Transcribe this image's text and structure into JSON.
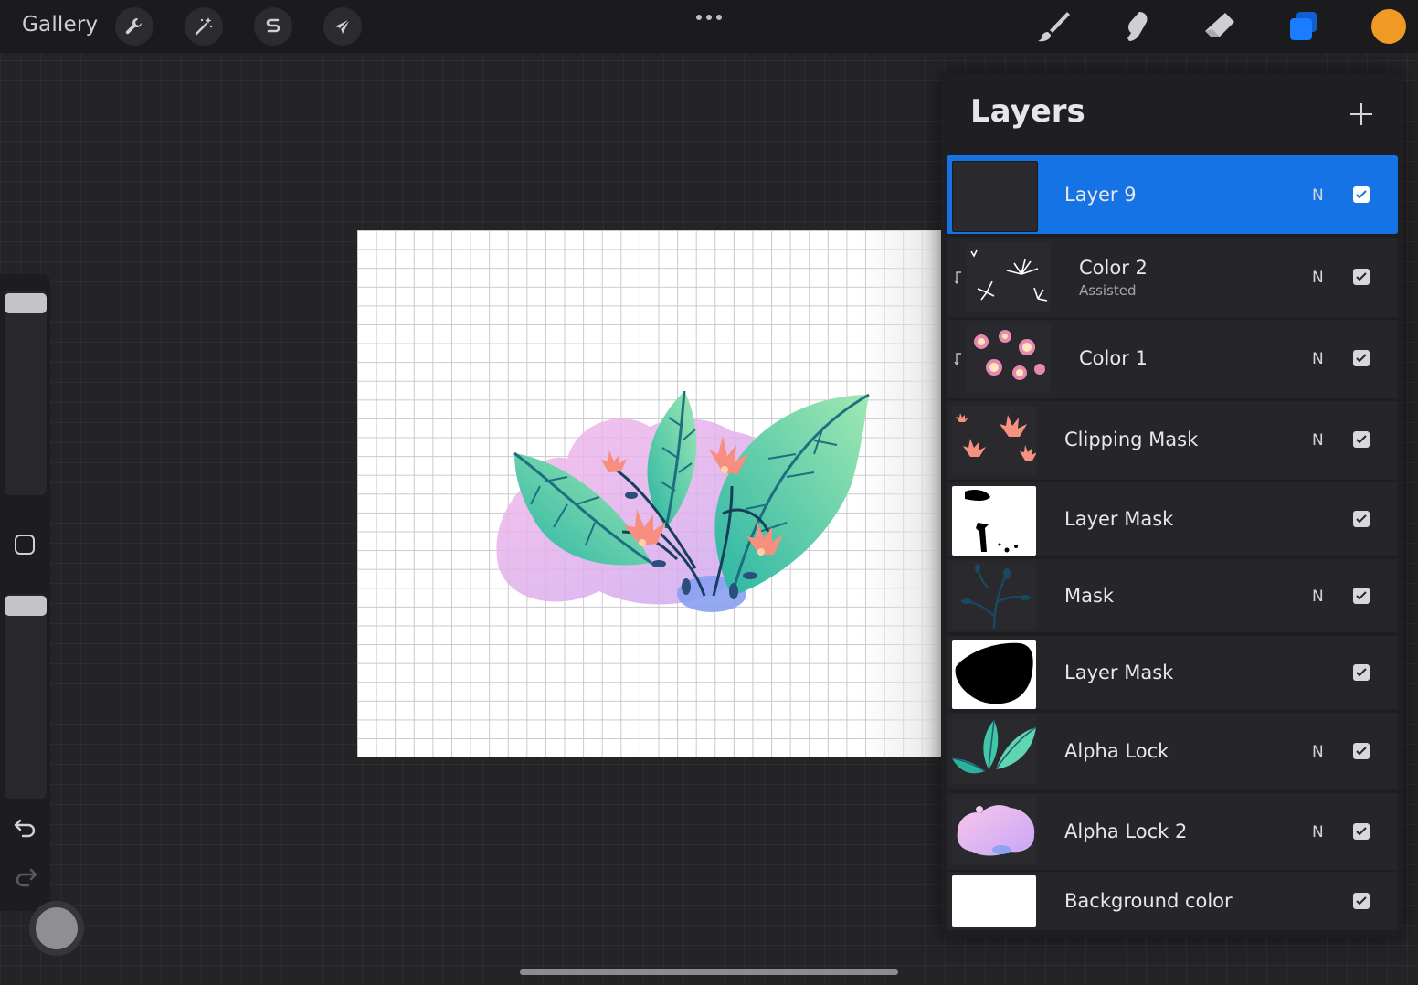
{
  "topbar": {
    "gallery_label": "Gallery",
    "tools_left": [
      "wrench-icon",
      "magic-wand-icon",
      "selection-s-icon",
      "transform-arrow-icon"
    ],
    "tools_right": [
      "brush-icon",
      "smudge-icon",
      "eraser-icon",
      "layers-icon"
    ],
    "accent": "#1673e6",
    "current_color": "#ef9a24"
  },
  "layers_panel": {
    "title": "Layers",
    "layers": [
      {
        "name": "Layer 9",
        "subtitle": "",
        "mode": "N",
        "visible": true,
        "selected": true,
        "clipped": false
      },
      {
        "name": "Color 2",
        "subtitle": "Assisted",
        "mode": "N",
        "visible": true,
        "selected": false,
        "clipped": true
      },
      {
        "name": "Color 1",
        "subtitle": "",
        "mode": "N",
        "visible": true,
        "selected": false,
        "clipped": true
      },
      {
        "name": "Clipping Mask",
        "subtitle": "",
        "mode": "N",
        "visible": true,
        "selected": false,
        "clipped": false
      },
      {
        "name": "Layer Mask",
        "subtitle": "",
        "mode": "",
        "visible": true,
        "selected": false,
        "clipped": false
      },
      {
        "name": "Mask",
        "subtitle": "",
        "mode": "N",
        "visible": true,
        "selected": false,
        "clipped": false
      },
      {
        "name": "Layer Mask",
        "subtitle": "",
        "mode": "",
        "visible": true,
        "selected": false,
        "clipped": false
      },
      {
        "name": "Alpha Lock",
        "subtitle": "",
        "mode": "N",
        "visible": true,
        "selected": false,
        "clipped": false
      },
      {
        "name": "Alpha Lock 2",
        "subtitle": "",
        "mode": "N",
        "visible": true,
        "selected": false,
        "clipped": false
      },
      {
        "name": "Background color",
        "subtitle": "",
        "mode": "",
        "visible": true,
        "selected": false,
        "clipped": false
      }
    ]
  }
}
